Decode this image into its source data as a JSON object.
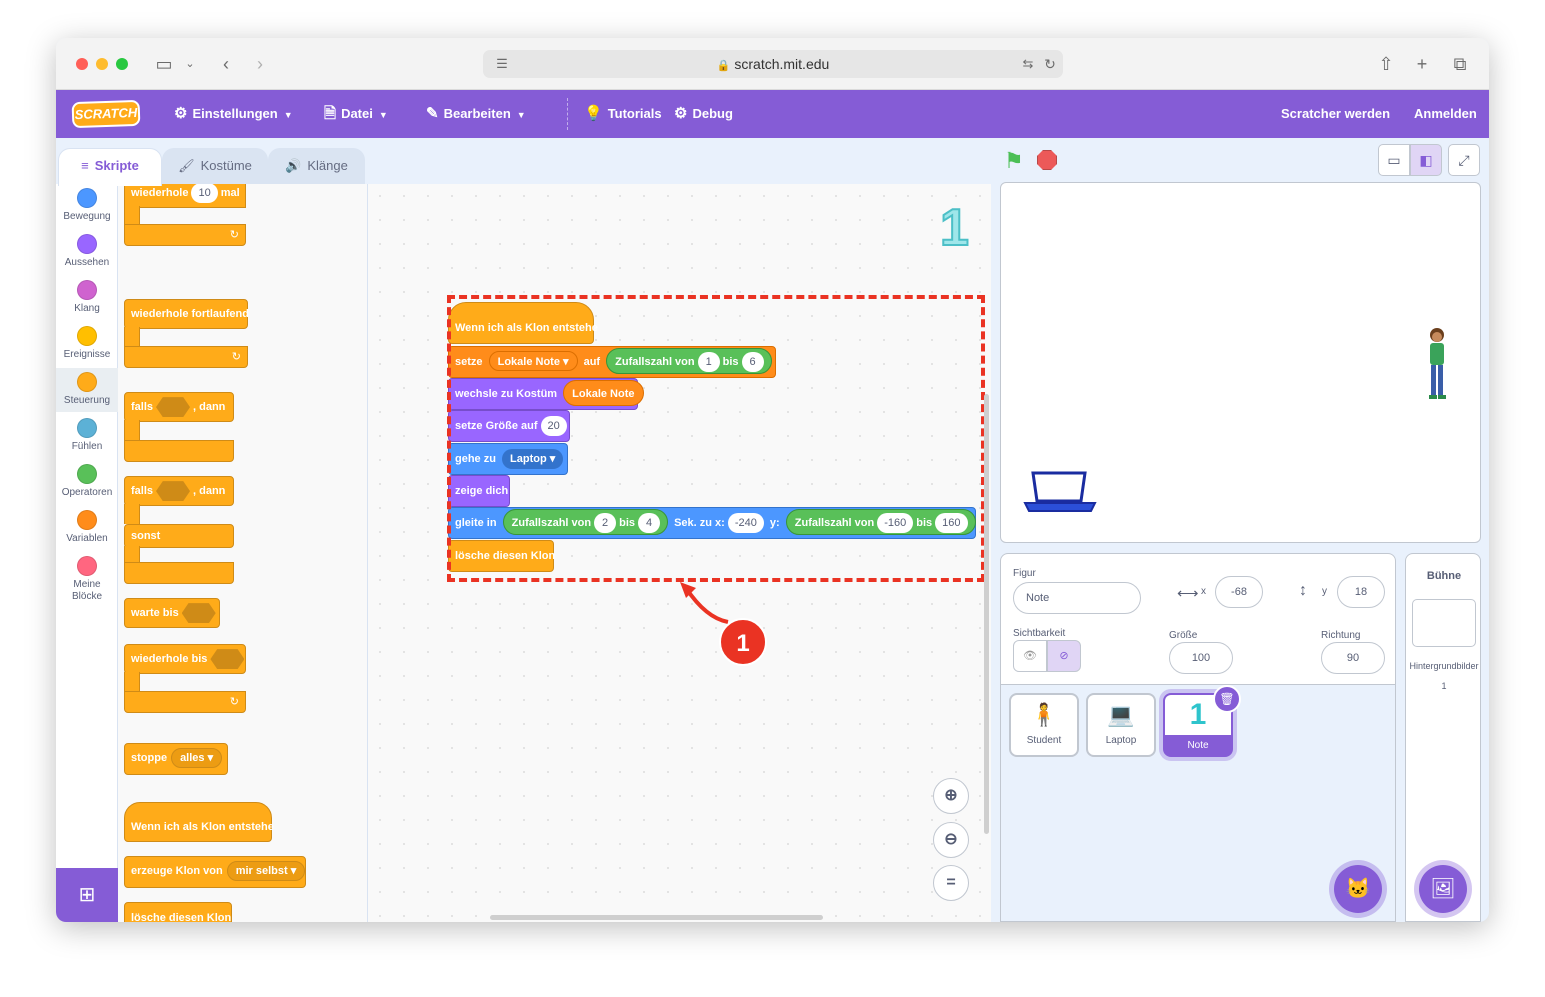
{
  "browser": {
    "url": "scratch.mit.edu"
  },
  "menubar": {
    "logo": "SCRATCH",
    "settings": "Einstellungen",
    "file": "Datei",
    "edit": "Bearbeiten",
    "tutorials": "Tutorials",
    "debug": "Debug",
    "join": "Scratcher werden",
    "signin": "Anmelden"
  },
  "tabs": {
    "code": "Skripte",
    "costumes": "Kostüme",
    "sounds": "Klänge"
  },
  "categories": [
    {
      "label": "Bewegung",
      "color": "#4c97ff"
    },
    {
      "label": "Aussehen",
      "color": "#9966ff"
    },
    {
      "label": "Klang",
      "color": "#cf63cf"
    },
    {
      "label": "Ereignisse",
      "color": "#ffbf00"
    },
    {
      "label": "Steuerung",
      "color": "#ffab19"
    },
    {
      "label": "Fühlen",
      "color": "#5cb1d6"
    },
    {
      "label": "Operatoren",
      "color": "#59c059"
    },
    {
      "label": "Variablen",
      "color": "#ff8c1a"
    },
    {
      "label": "Meine Blöcke",
      "color": "#ff6680"
    }
  ],
  "palette": {
    "repeat": "wiederhole",
    "repeat_count": "10",
    "repeat_unit": "mal",
    "forever": "wiederhole fortlaufend",
    "if": "falls",
    "then": ", dann",
    "if2": "falls",
    "then2": ", dann",
    "else": "sonst",
    "wait_until": "warte bis",
    "repeat_until": "wiederhole bis",
    "stop": "stoppe",
    "stop_option": "alles",
    "clone_hat": "Wenn ich als Klon entstehe",
    "create_clone": "erzeuge Klon von",
    "create_clone_option": "mir selbst",
    "delete_clone": "lösche diesen Klon"
  },
  "script": {
    "hat": "Wenn ich als Klon entstehe",
    "set": "setze",
    "set_var": "Lokale Note",
    "set_to": "auf",
    "random": "Zufallszahl von",
    "rand_from": "1",
    "rand_bis": "bis",
    "rand_to": "6",
    "switch_costume": "wechsle zu Kostüm",
    "costume_var": "Lokale Note",
    "set_size": "setze Größe auf",
    "size_val": "20",
    "goto": "gehe zu",
    "goto_target": "Laptop",
    "show": "zeige dich",
    "glide": "gleite in",
    "glide_random": "Zufallszahl von",
    "glide_from": "2",
    "glide_bis": "bis",
    "glide_to": "4",
    "glide_secs": "Sek. zu x:",
    "glide_x": "-240",
    "glide_y_label": "y:",
    "glide_y_random": "Zufallszahl von",
    "glide_y_from": "-160",
    "glide_y_bis": "bis",
    "glide_y_to": "160",
    "delete_clone": "lösche diesen Klon"
  },
  "sprite_glyph": "1",
  "callout": "1",
  "sprite_info": {
    "sprite_label": "Figur",
    "sprite_name": "Note",
    "x_label": "x",
    "x_val": "-68",
    "y_label": "y",
    "y_val": "18",
    "visibility_label": "Sichtbarkeit",
    "size_label": "Größe",
    "size_val": "100",
    "direction_label": "Richtung",
    "direction_val": "90"
  },
  "sprites": [
    "Student",
    "Laptop",
    "Note"
  ],
  "stage_panel": {
    "title": "Bühne",
    "backdrops_label": "Hintergrundbilder",
    "backdrops_count": "1"
  }
}
